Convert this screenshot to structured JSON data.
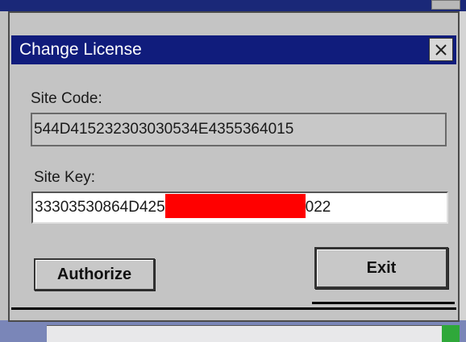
{
  "dialog": {
    "title": "Change License",
    "close_glyph": "×",
    "site_code_label": "Site Code:",
    "site_code_value": "544D415232303030534E4355364015",
    "site_key_label": "Site Key:",
    "site_key_prefix": "33303530864D425",
    "site_key_suffix": "022",
    "authorize_label": "Authorize",
    "exit_label": "Exit"
  },
  "colors": {
    "titlebar": "#101c7c",
    "dialog_bg": "#c4c4c4",
    "redaction": "#ff0000"
  },
  "icons": {
    "close": "close-icon"
  }
}
